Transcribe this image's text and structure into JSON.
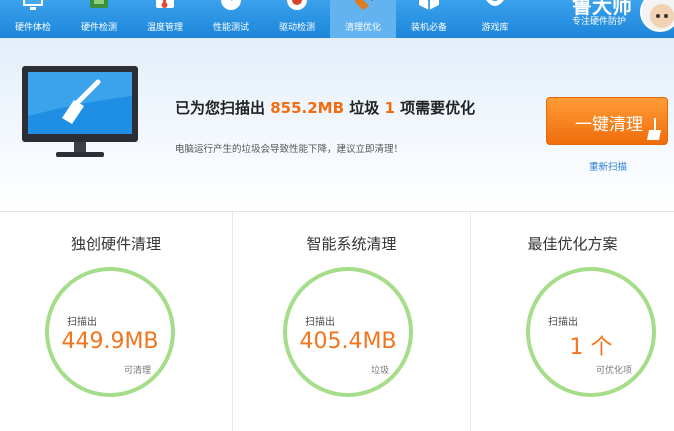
{
  "nav": {
    "items": [
      {
        "label": "硬件体检",
        "icon": "computer-icon"
      },
      {
        "label": "硬件检测",
        "icon": "chip-icon"
      },
      {
        "label": "温度管理",
        "icon": "thermometer-icon"
      },
      {
        "label": "性能测试",
        "icon": "speedometer-icon"
      },
      {
        "label": "驱动检测",
        "icon": "gear-icon"
      },
      {
        "label": "清理优化",
        "icon": "broom-icon"
      },
      {
        "label": "装机必备",
        "icon": "cube-icon"
      },
      {
        "label": "游戏库",
        "icon": "gamepad-icon"
      }
    ],
    "active": "清理优化"
  },
  "brand": {
    "title": "鲁大师",
    "subtitle": "专注硬件防护"
  },
  "banner": {
    "prefix": "已为您扫描出 ",
    "size": "855.2MB",
    "mid": " 垃圾 ",
    "count": "1",
    "suffix": " 项需要优化",
    "subtitle": "电脑运行产生的垃圾会导致性能下降，建议立即清理！",
    "clean_button": "一键清理",
    "rescan_link": "重新扫描"
  },
  "panels": [
    {
      "title": "独创硬件清理",
      "label": "扫描出",
      "value": "449.9MB",
      "unit": "可清理"
    },
    {
      "title": "智能系统清理",
      "label": "扫描出",
      "value": "405.4MB",
      "unit": "垃圾"
    },
    {
      "title": "最佳优化方案",
      "label": "扫描出",
      "value": "1 个",
      "unit": "可优化项"
    }
  ],
  "colors": {
    "nav_bar": "#1d86da",
    "accent_orange": "#f26d12",
    "ring_green": "#a6dd8a",
    "link_blue": "#2a7ed6"
  }
}
